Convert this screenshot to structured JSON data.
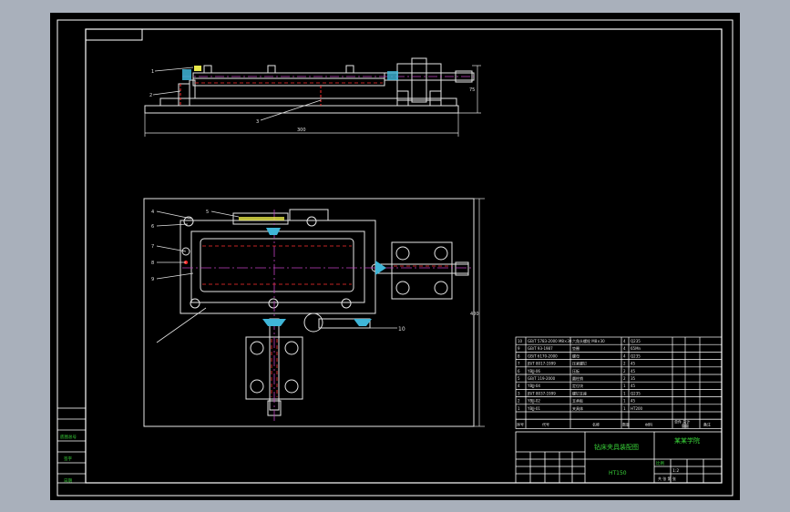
{
  "colors": {
    "viewport": "#a9b0bb",
    "paper": "#000000",
    "frame": "#ffffff",
    "outline": "#e6e6e6",
    "hidden": "#ff3030",
    "center": "#c040c0",
    "dim": "#e0e0e0",
    "cyan": "#3fb6d8",
    "yellow": "#e8e84a",
    "green": "#39d339",
    "red": "#ff2b2b"
  },
  "front_view": {
    "callouts": [
      "1",
      "2",
      "3"
    ],
    "dim_width": "300",
    "dim_height": "75"
  },
  "top_view": {
    "callouts": [
      "4",
      "5",
      "6",
      "7",
      "8",
      "9"
    ],
    "callout_10": "10",
    "dim_height": "400"
  },
  "bom": {
    "rows": [
      {
        "no": "10",
        "code": "GB/T 5783-2000 M8×30",
        "name": "六角头螺栓 M8×30",
        "qty": "4",
        "material": "Q235",
        "note": ""
      },
      {
        "no": "9",
        "code": "GB/T 93-1987",
        "name": "垫圈",
        "qty": "4",
        "material": "65Mn",
        "note": ""
      },
      {
        "no": "8",
        "code": "GB/T 6170-2000",
        "name": "螺母",
        "qty": "4",
        "material": "Q235",
        "note": ""
      },
      {
        "no": "7",
        "code": "JB/T 8017-1999",
        "name": "压紧螺钉",
        "qty": "2",
        "material": "45",
        "note": ""
      },
      {
        "no": "6",
        "code": "YBJJ-06",
        "name": "压板",
        "qty": "2",
        "material": "45",
        "note": ""
      },
      {
        "no": "5",
        "code": "GB/T 119-2000",
        "name": "圆柱销",
        "qty": "2",
        "material": "35",
        "note": ""
      },
      {
        "no": "4",
        "code": "YBJJ-04",
        "name": "定位块",
        "qty": "1",
        "material": "45",
        "note": ""
      },
      {
        "no": "3",
        "code": "JB/T 8037-1999",
        "name": "螺钉支座",
        "qty": "1",
        "material": "Q235",
        "note": ""
      },
      {
        "no": "2",
        "code": "YBJJ-02",
        "name": "支承板",
        "qty": "1",
        "material": "45",
        "note": ""
      },
      {
        "no": "1",
        "code": "YBJJ-01",
        "name": "夹具体",
        "qty": "1",
        "material": "HT200",
        "note": ""
      }
    ],
    "headers": {
      "no": "序号",
      "code": "代号",
      "name": "名称",
      "qty": "数量",
      "material": "材料",
      "weight": "单件 总计",
      "mass": "重量",
      "note": "备注"
    }
  },
  "title_block": {
    "drawing_title": "钻床夹具装配图",
    "school": "某某学院",
    "material": "HT150",
    "scale_label": "比例",
    "scale": "1:2",
    "sheet": "共 张 第 张"
  },
  "side_block": {
    "rows": [
      "",
      "",
      "底图总号",
      "",
      "签字",
      "",
      "日期"
    ]
  }
}
